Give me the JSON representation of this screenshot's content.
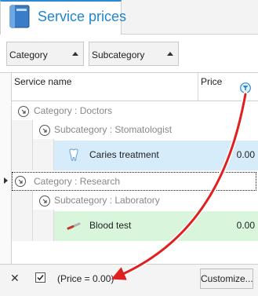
{
  "tab": {
    "label": "Service prices",
    "icon": "book-icon"
  },
  "group_panel": {
    "buttons": [
      {
        "label": "Category",
        "icon": "sort-ascending-icon"
      },
      {
        "label": "Subcategory",
        "icon": "sort-ascending-icon"
      }
    ]
  },
  "grid": {
    "columns": {
      "service": "Service name",
      "price": "Price",
      "filter_icon": "filter-icon"
    },
    "groups": [
      {
        "category": "Category : Doctors",
        "subgroups": [
          {
            "subcategory": "Subcategory : Stomatologist",
            "rows": [
              {
                "name": "Caries treatment",
                "price": "0.00",
                "icon": "tooth-icon",
                "row_color": "#d6ecfa"
              }
            ]
          }
        ]
      },
      {
        "category": "Category : Research",
        "subgroups": [
          {
            "subcategory": "Subcategory : Laboratory",
            "rows": [
              {
                "name": "Blood test",
                "price": "0.00",
                "icon": "test-tube-icon",
                "row_color": "#d9f5dc"
              }
            ]
          }
        ]
      }
    ]
  },
  "filter_bar": {
    "close_icon": "close-icon",
    "enabled": true,
    "expression": "(Price = 0.00)",
    "customize_label": "Customize..."
  },
  "annotation": {
    "arrow_color": "#e02020"
  }
}
